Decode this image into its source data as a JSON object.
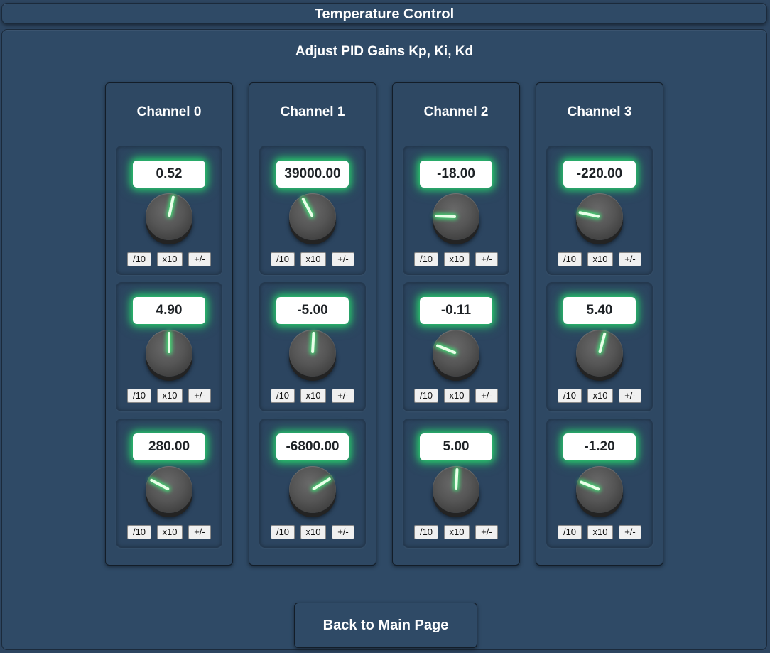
{
  "header": {
    "title": "Temperature Control"
  },
  "main": {
    "subtitle": "Adjust PID Gains Kp, Ki, Kd"
  },
  "buttons": {
    "divide": "/10",
    "multiply": "x10",
    "negate": "+/-"
  },
  "accent_glow": "#28dc6e",
  "channels": [
    {
      "title": "Channel 0",
      "gains": [
        {
          "value": "0.52",
          "knob_angle_deg": 12
        },
        {
          "value": "4.90",
          "knob_angle_deg": 0
        },
        {
          "value": "280.00",
          "knob_angle_deg": -62
        }
      ]
    },
    {
      "title": "Channel 1",
      "gains": [
        {
          "value": "39000.00",
          "knob_angle_deg": -28
        },
        {
          "value": "-5.00",
          "knob_angle_deg": 3
        },
        {
          "value": "-6800.00",
          "knob_angle_deg": 58
        }
      ]
    },
    {
      "title": "Channel 2",
      "gains": [
        {
          "value": "-18.00",
          "knob_angle_deg": -88
        },
        {
          "value": "-0.11",
          "knob_angle_deg": -68
        },
        {
          "value": "5.00",
          "knob_angle_deg": 3
        }
      ]
    },
    {
      "title": "Channel 3",
      "gains": [
        {
          "value": "-220.00",
          "knob_angle_deg": -78
        },
        {
          "value": "5.40",
          "knob_angle_deg": 15
        },
        {
          "value": "-1.20",
          "knob_angle_deg": -68
        }
      ]
    }
  ],
  "footer": {
    "back_label": "Back to Main Page"
  }
}
